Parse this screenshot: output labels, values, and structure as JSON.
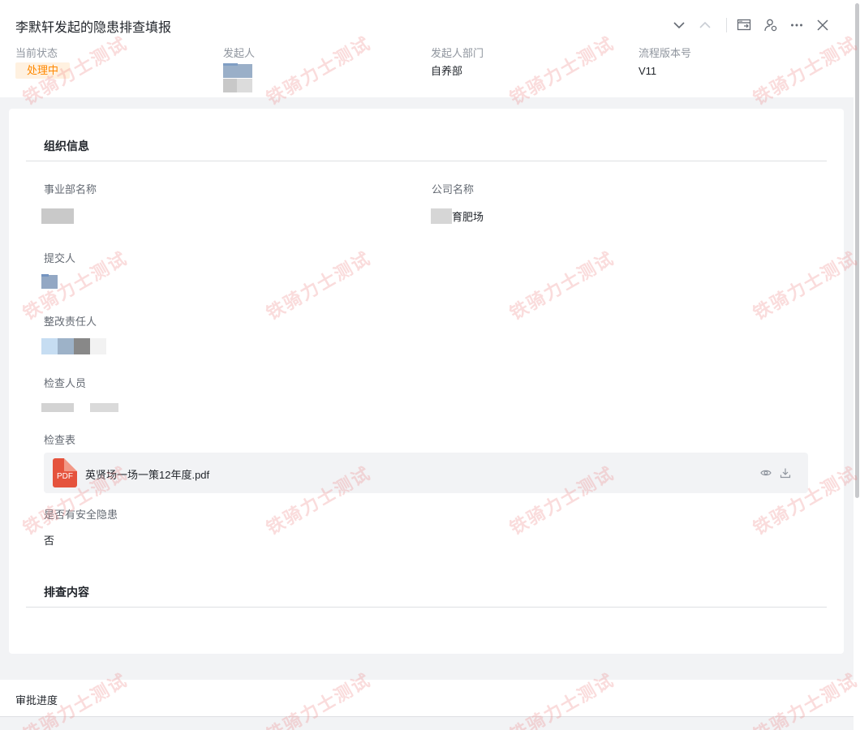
{
  "header": {
    "title": "李默轩发起的隐患排查填报",
    "toolbar_icons": [
      "chevron-down-icon",
      "chevron-up-icon",
      "open-window-icon",
      "user-share-icon",
      "more-icon",
      "close-icon"
    ],
    "meta": {
      "status_label": "当前状态",
      "status_value": "处理中",
      "initiator_label": "发起人",
      "dept_label": "发起人部门",
      "dept_value": "自养部",
      "version_label": "流程版本号",
      "version_value": "V11"
    }
  },
  "org_section": {
    "title": "组织信息",
    "division_label": "事业部名称",
    "company_label": "公司名称",
    "company_value_visible": "育肥场",
    "submitter_label": "提交人",
    "rectifier_label": "整改责任人",
    "inspector_label": "检查人员",
    "checklist_label": "检查表",
    "file_badge": "PDF",
    "file_name": "英贤场一场一策12年度.pdf",
    "hazard_label": "是否有安全隐患",
    "hazard_value": "否"
  },
  "content_section": {
    "title": "排查内容"
  },
  "footer": {
    "title": "审批进度"
  },
  "watermark": "铁骑力士测试",
  "colors": {
    "status_text": "#ff8800",
    "status_bg": "#fff1e0",
    "pdf_icon": "#e5533d",
    "watermark": "#ec8282"
  }
}
